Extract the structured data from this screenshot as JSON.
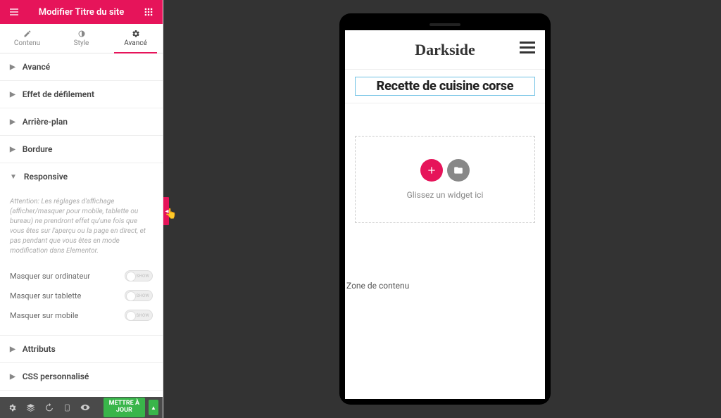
{
  "colors": {
    "accent": "#e6145a",
    "success": "#39b54a",
    "bg_dark": "#333333"
  },
  "header": {
    "title": "Modifier Titre du site"
  },
  "tabs": {
    "content": "Contenu",
    "style": "Style",
    "advanced": "Avancé"
  },
  "accordion": {
    "advanced": "Avancé",
    "scroll_effect": "Effet de défilement",
    "background": "Arrière-plan",
    "border": "Bordure",
    "responsive": "Responsive",
    "attributes": "Attributs",
    "custom_css": "CSS personnalisé"
  },
  "responsive": {
    "warning": "Attention: Les réglages d'affichage (afficher/masquer pour mobile, tablette ou bureau) ne prendront effet qu'une fois que vous êtes sur l'aperçu ou la page en direct, et pas pendant que vous êtes en mode modification dans Elementor.",
    "hide_desktop": "Masquer sur ordinateur",
    "hide_tablet": "Masquer sur tablette",
    "hide_mobile": "Masquer sur mobile",
    "toggle_label": "SHOW"
  },
  "footer": {
    "update_button": "METTRE À\nJOUR"
  },
  "preview": {
    "brand": "Darkside",
    "page_title": "Recette de cuisine corse",
    "dropzone_hint": "Glissez un widget ici",
    "content_zone": "Zone de contenu"
  }
}
